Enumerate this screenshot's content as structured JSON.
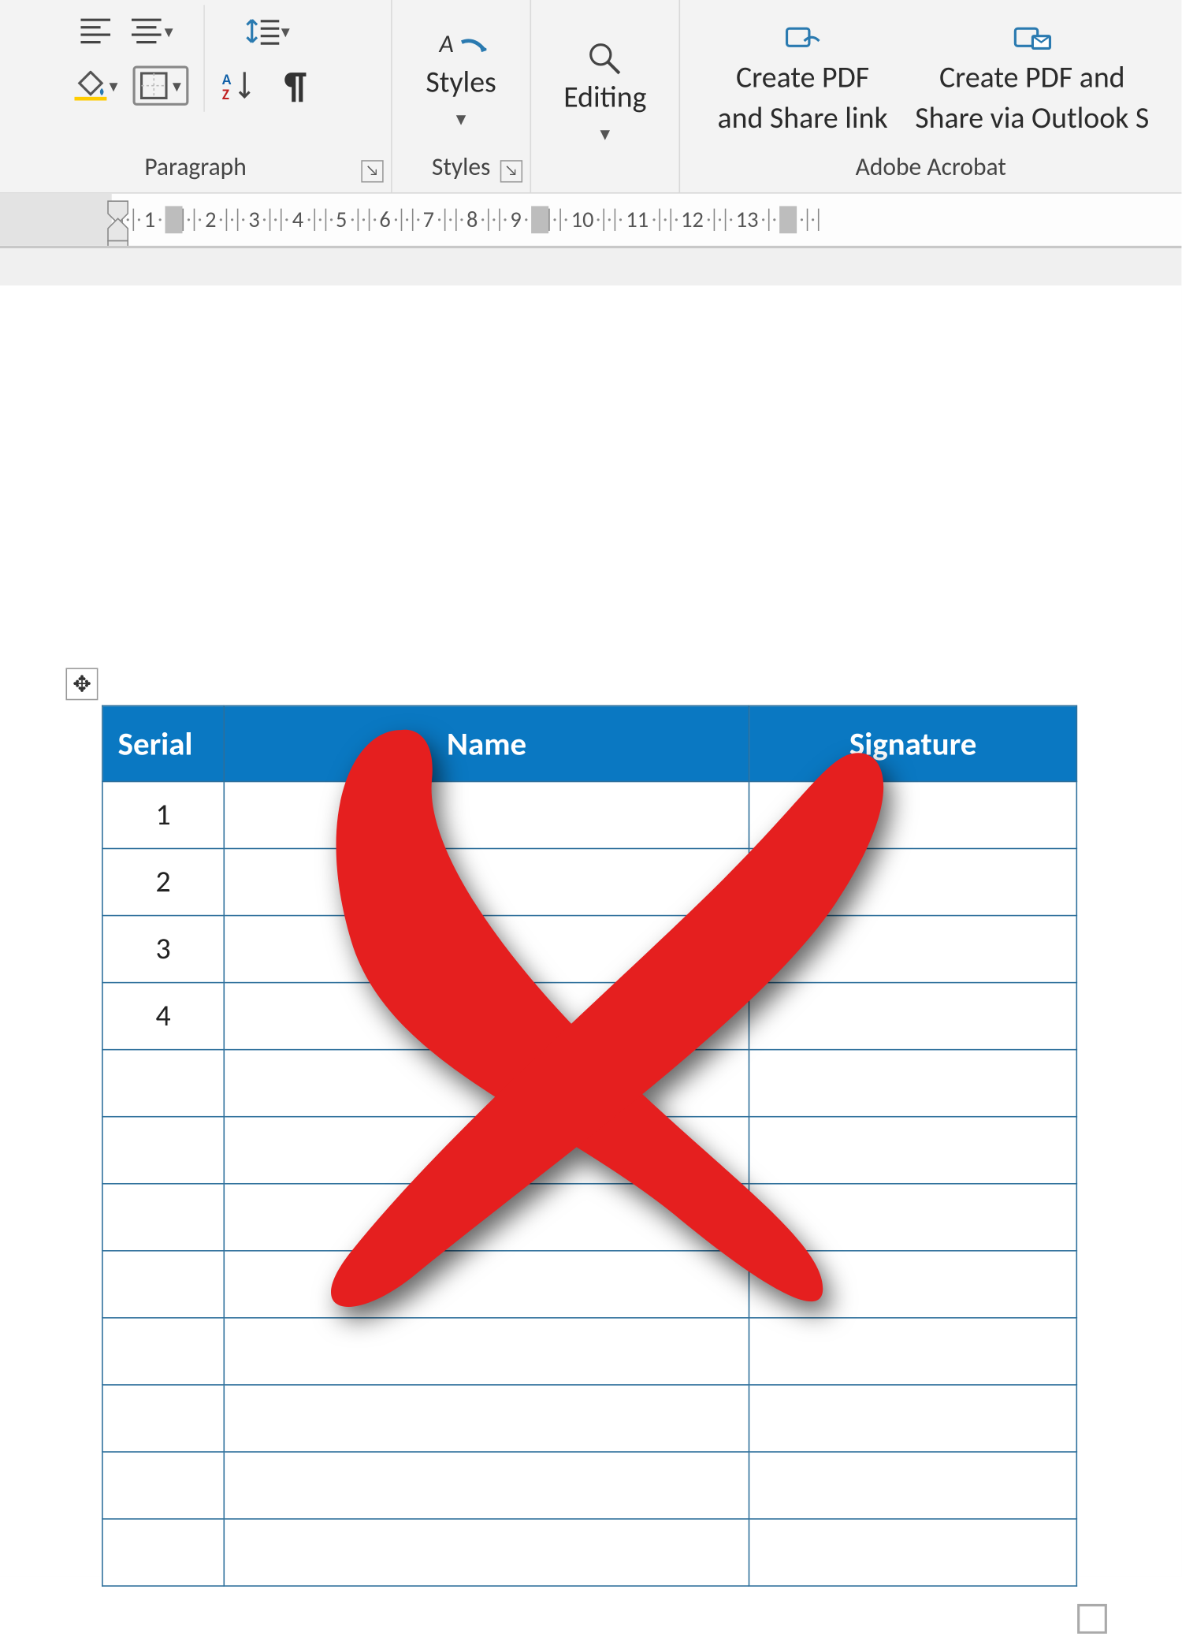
{
  "ribbon": {
    "paragraph_label": "Paragraph",
    "styles_button": "Styles",
    "styles_group_label": "Styles",
    "editing_button": "Editing",
    "acrobat_group_label": "Adobe Acrobat",
    "create_pdf_share_link_line1": "Create PDF",
    "create_pdf_share_link_line2": "and Share link",
    "create_pdf_outlook_line1": "Create PDF and",
    "create_pdf_outlook_line2": "Share via Outlook",
    "outlook_trailing": "S"
  },
  "ruler": {
    "numbers": [
      "1",
      "2",
      "3",
      "4",
      "5",
      "6",
      "7",
      "8",
      "9",
      "10",
      "11",
      "12",
      "13"
    ]
  },
  "table": {
    "headers": {
      "serial": "Serial",
      "name": "Name",
      "signature": "Signature"
    },
    "rows": [
      {
        "serial": "1",
        "name": "",
        "signature": ""
      },
      {
        "serial": "2",
        "name": "",
        "signature": ""
      },
      {
        "serial": "3",
        "name": "",
        "signature": ""
      },
      {
        "serial": "4",
        "name": "",
        "signature": ""
      },
      {
        "serial": "",
        "name": "",
        "signature": ""
      },
      {
        "serial": "",
        "name": "",
        "signature": ""
      },
      {
        "serial": "",
        "name": "",
        "signature": ""
      },
      {
        "serial": "",
        "name": "",
        "signature": ""
      },
      {
        "serial": "",
        "name": "",
        "signature": ""
      },
      {
        "serial": "",
        "name": "",
        "signature": ""
      },
      {
        "serial": "",
        "name": "",
        "signature": ""
      },
      {
        "serial": "",
        "name": "",
        "signature": ""
      }
    ]
  }
}
